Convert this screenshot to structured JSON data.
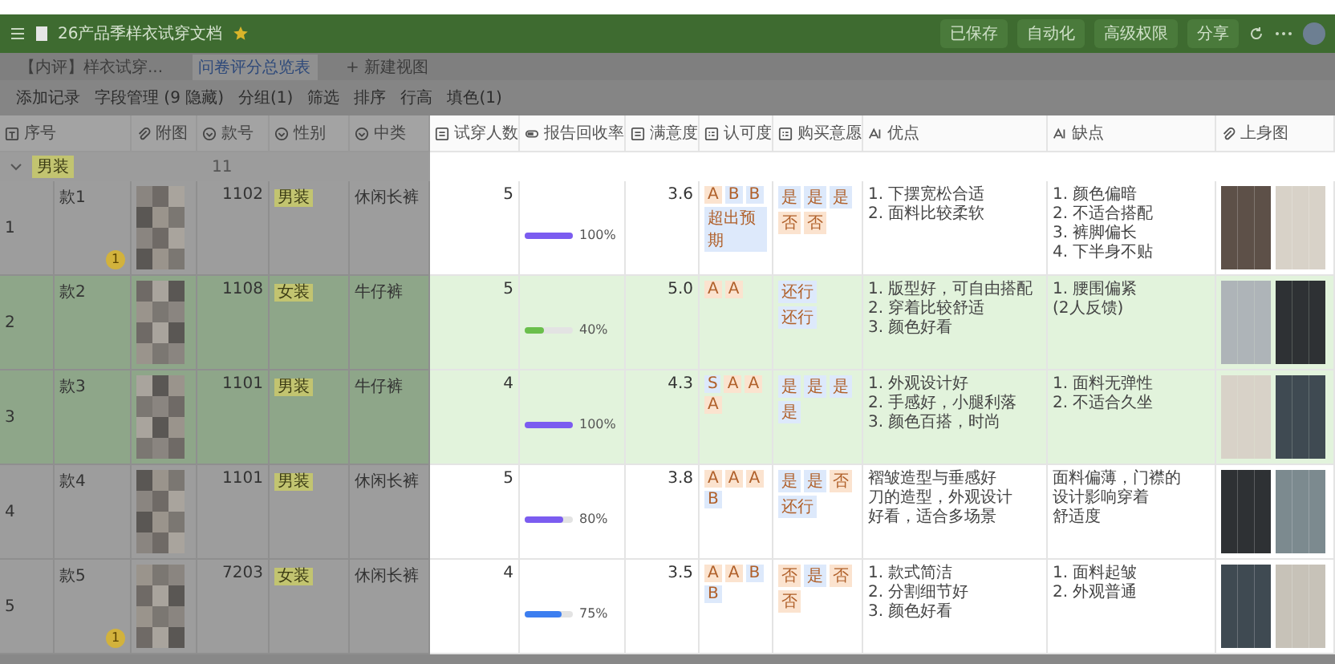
{
  "window": {
    "title": "26产品季样衣试穿文档",
    "starred": true,
    "actions": [
      "已保存",
      "自动化",
      "高级权限",
      "分享"
    ]
  },
  "tabs": [
    {
      "label": "【内评】样衣试穿...",
      "selected": false
    },
    {
      "label": "问卷评分总览表",
      "selected": true
    },
    {
      "label": "+ 新建视图",
      "selected": false
    }
  ],
  "toolbar": [
    "添加记录",
    "字段管理 (9 隐藏)",
    "分组(1)",
    "筛选",
    "排序",
    "行高",
    "填色(1)"
  ],
  "columns": [
    {
      "label": "序号",
      "kind": "text"
    },
    {
      "label": "附图",
      "kind": "attachment"
    },
    {
      "label": "款号",
      "kind": "single"
    },
    {
      "label": "性别",
      "kind": "single"
    },
    {
      "label": "中类",
      "kind": "single"
    },
    {
      "label": "试穿人数",
      "kind": "number"
    },
    {
      "label": "报告回收率",
      "kind": "progress"
    },
    {
      "label": "满意度",
      "kind": "number"
    },
    {
      "label": "认可度",
      "kind": "multi"
    },
    {
      "label": "购买意愿",
      "kind": "multi"
    },
    {
      "label": "优点",
      "kind": "ai"
    },
    {
      "label": "缺点",
      "kind": "ai"
    },
    {
      "label": "上身图",
      "kind": "attachment"
    }
  ],
  "group": {
    "label": "男装",
    "count": "11",
    "expanded": true
  },
  "rows": [
    {
      "index": "1",
      "name": "款1",
      "comments": "1",
      "code": "1102",
      "gender": "男装",
      "category": "休闲长裤",
      "highlighted": false,
      "testers": "5",
      "recovery": {
        "level": 1.0,
        "reading": "100%",
        "color": "#7b5cf0"
      },
      "satisfaction": "3.6",
      "approval": [
        {
          "text": "A",
          "color": "#fbe3cf"
        },
        {
          "text": "B",
          "color": "#dde9fb"
        },
        {
          "text": "B",
          "color": "#dde9fb"
        },
        {
          "text": "超出预期",
          "color": "#dde9fb"
        }
      ],
      "purchase": [
        {
          "text": "是",
          "color": "#dde9fb"
        },
        {
          "text": "是",
          "color": "#dde9fb"
        },
        {
          "text": "是",
          "color": "#dde9fb"
        },
        {
          "text": "否",
          "color": "#fbe3cf"
        },
        {
          "text": "否",
          "color": "#fbe3cf"
        }
      ],
      "pros": [
        "1. 下摆宽松合适",
        "2. 面料比较柔软"
      ],
      "cons": [
        "1. 颜色偏暗",
        "2. 不适合搭配",
        "3. 裤脚偏长",
        "4. 下半身不贴"
      ]
    },
    {
      "index": "2",
      "name": "款2",
      "comments": "",
      "code": "1108",
      "gender": "女装",
      "category": "牛仔裤",
      "highlighted": true,
      "testers": "5",
      "recovery": {
        "level": 0.4,
        "reading": "40%",
        "color": "#6abf4b"
      },
      "satisfaction": "5.0",
      "approval": [
        {
          "text": "A",
          "color": "#fbe3cf"
        },
        {
          "text": "A",
          "color": "#fbe3cf"
        }
      ],
      "purchase": [
        {
          "text": "还行",
          "color": "#dde9fb"
        },
        {
          "text": "还行",
          "color": "#dde9fb"
        }
      ],
      "pros": [
        "1. 版型好，可自由搭配",
        "2. 穿着比较舒适",
        "3. 颜色好看"
      ],
      "cons": [
        "1. 腰围偏紧",
        "(2人反馈)"
      ]
    },
    {
      "index": "3",
      "name": "款3",
      "comments": "",
      "code": "1101",
      "gender": "男装",
      "category": "牛仔裤",
      "highlighted": true,
      "testers": "4",
      "recovery": {
        "level": 1.0,
        "reading": "100%",
        "color": "#7b5cf0"
      },
      "satisfaction": "4.3",
      "approval": [
        {
          "text": "S",
          "color": "#dde9fb"
        },
        {
          "text": "A",
          "color": "#fbe3cf"
        },
        {
          "text": "A",
          "color": "#fbe3cf"
        },
        {
          "text": "A",
          "color": "#fbe3cf"
        }
      ],
      "purchase": [
        {
          "text": "是",
          "color": "#dde9fb"
        },
        {
          "text": "是",
          "color": "#dde9fb"
        },
        {
          "text": "是",
          "color": "#dde9fb"
        },
        {
          "text": "是",
          "color": "#dde9fb"
        }
      ],
      "pros": [
        "1. 外观设计好",
        "2. 手感好，小腿利落",
        "3. 颜色百搭，时尚"
      ],
      "cons": [
        "1. 面料无弹性",
        "2. 不适合久坐"
      ]
    },
    {
      "index": "4",
      "name": "款4",
      "comments": "",
      "code": "1101",
      "gender": "男装",
      "category": "休闲长裤",
      "highlighted": false,
      "testers": "5",
      "recovery": {
        "level": 0.8,
        "reading": "80%",
        "color": "#7b5cf0"
      },
      "satisfaction": "3.8",
      "approval": [
        {
          "text": "A",
          "color": "#fbe3cf"
        },
        {
          "text": "A",
          "color": "#fbe3cf"
        },
        {
          "text": "A",
          "color": "#fbe3cf"
        },
        {
          "text": "B",
          "color": "#dde9fb"
        }
      ],
      "purchase": [
        {
          "text": "是",
          "color": "#dde9fb"
        },
        {
          "text": "是",
          "color": "#dde9fb"
        },
        {
          "text": "否",
          "color": "#fbe3cf"
        },
        {
          "text": "还行",
          "color": "#dde9fb"
        }
      ],
      "pros": [
        "褶皱造型与垂感好",
        "刀的造型，外观设计",
        "好看，适合多场景"
      ],
      "cons": [
        "面料偏薄，门襟的",
        "设计影响穿着",
        "舒适度"
      ]
    },
    {
      "index": "5",
      "name": "款5",
      "comments": "1",
      "code": "7203",
      "gender": "女装",
      "category": "休闲长裤",
      "highlighted": false,
      "testers": "4",
      "recovery": {
        "level": 0.75,
        "reading": "75%",
        "color": "#3c7ef0"
      },
      "satisfaction": "3.5",
      "approval": [
        {
          "text": "A",
          "color": "#fbe3cf"
        },
        {
          "text": "A",
          "color": "#fbe3cf"
        },
        {
          "text": "B",
          "color": "#dde9fb"
        },
        {
          "text": "B",
          "color": "#dde9fb"
        }
      ],
      "purchase": [
        {
          "text": "否",
          "color": "#fbe3cf"
        },
        {
          "text": "是",
          "color": "#dde9fb"
        },
        {
          "text": "否",
          "color": "#fbe3cf"
        },
        {
          "text": "否",
          "color": "#fbe3cf"
        }
      ],
      "pros": [
        "1. 款式简洁",
        "2. 分割细节好",
        "3. 颜色好看"
      ],
      "cons": [
        "1. 面料起皱",
        "2. 外观普通"
      ]
    }
  ]
}
